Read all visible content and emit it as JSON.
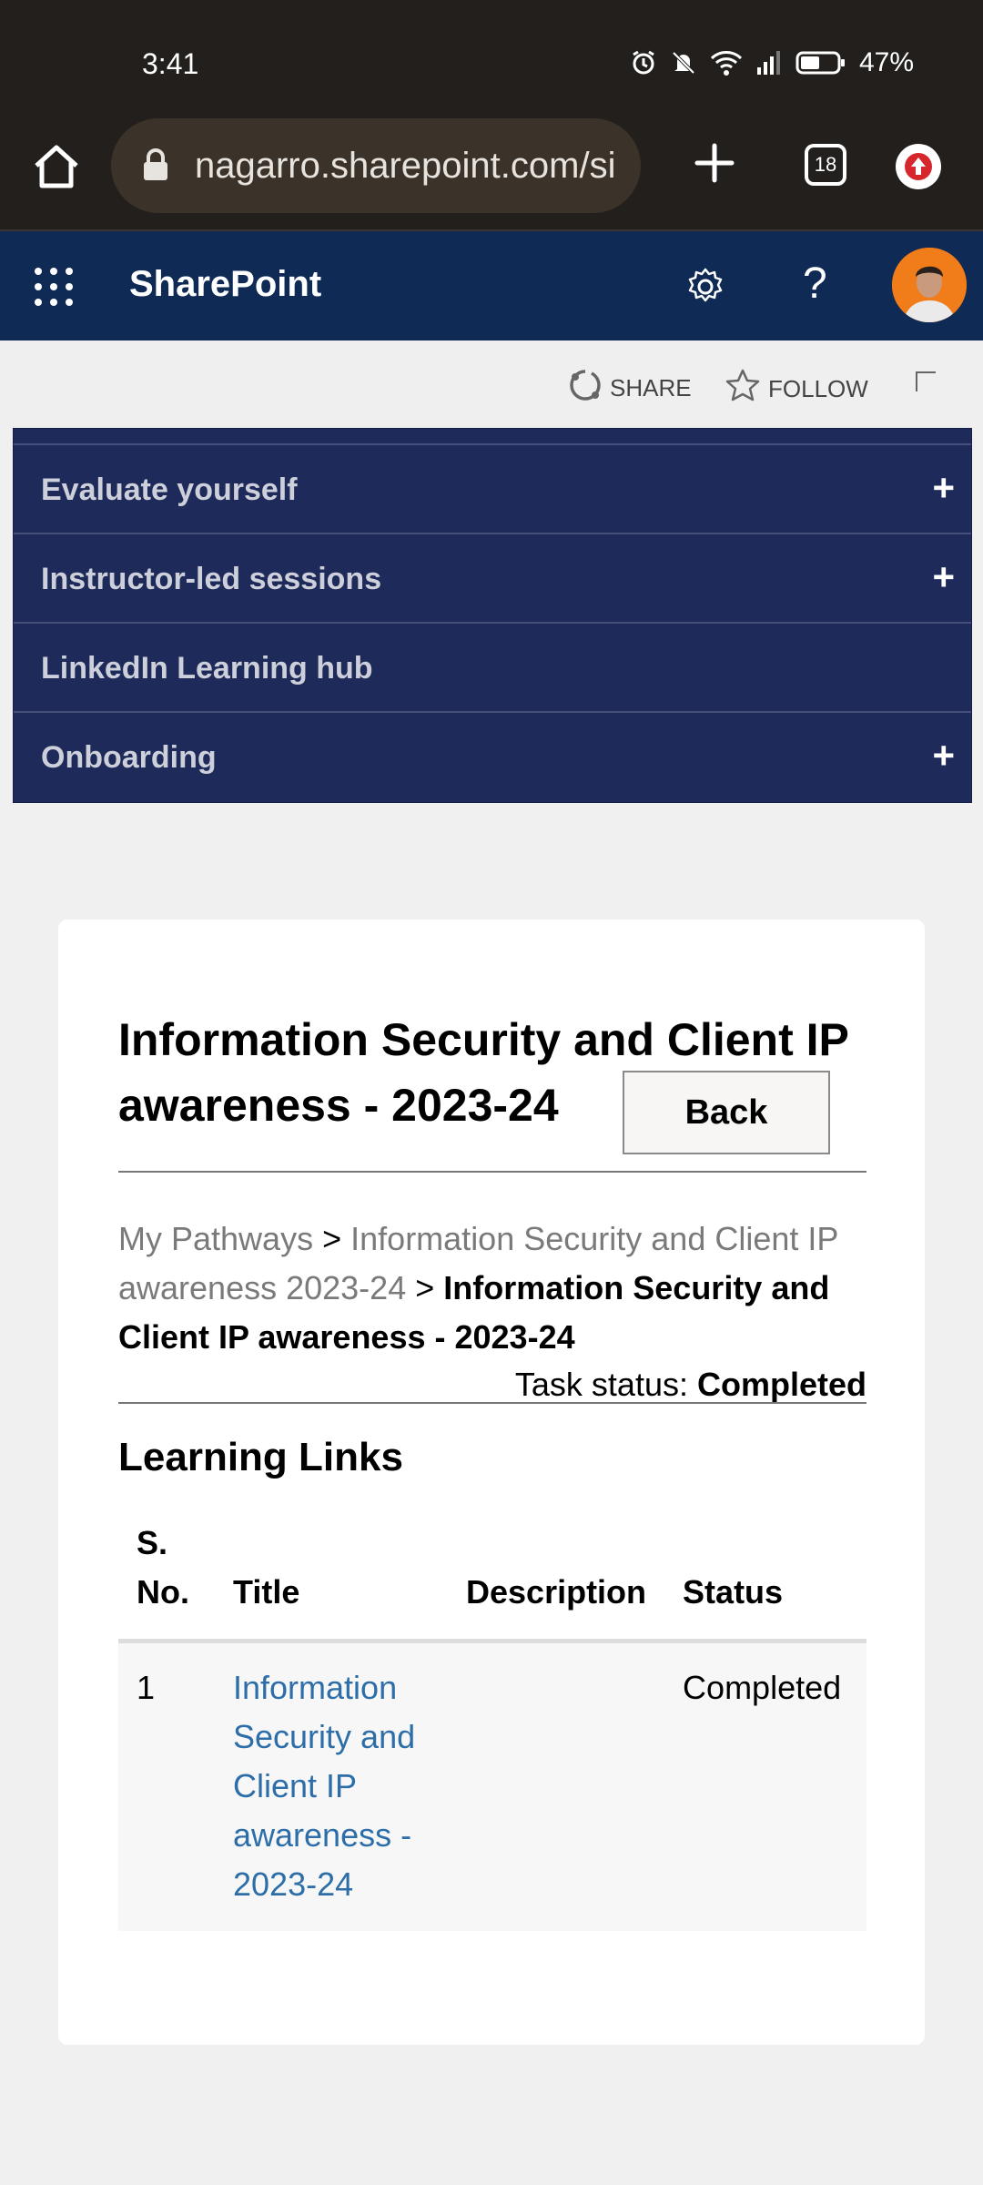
{
  "status_bar": {
    "time": "3:41",
    "battery": "47%",
    "icons": [
      "alarm-icon",
      "mute-icon",
      "wifi-icon",
      "signal-icon",
      "battery-icon"
    ]
  },
  "browser": {
    "url": "nagarro.sharepoint.com/si",
    "tab_count": "18"
  },
  "header": {
    "app_name": "SharePoint"
  },
  "actions": {
    "share": "SHARE",
    "follow": "FOLLOW"
  },
  "nav": {
    "items": [
      {
        "label": "Evaluate yourself",
        "expandable": true
      },
      {
        "label": "Instructor-led sessions",
        "expandable": true
      },
      {
        "label": "LinkedIn Learning hub",
        "expandable": false
      },
      {
        "label": "Onboarding",
        "expandable": true
      }
    ],
    "expand_glyph": "+"
  },
  "page": {
    "title": "Information Security and Client IP awareness - 2023-24",
    "back_label": "Back",
    "breadcrumb": {
      "crumb1": "My Pathways",
      "separator": ">",
      "crumb2": "Information Security and Client IP awareness 2023-24",
      "current": "Information Security and Client IP awareness - 2023-24"
    },
    "task_status_label": "Task status:",
    "task_status_value": "Completed",
    "section_title": "Learning Links",
    "table": {
      "headers": {
        "no": "S. No.",
        "title": "Title",
        "description": "Description",
        "status": "Status"
      },
      "rows": [
        {
          "no": "1",
          "title": "Information Security and Client IP awareness - 2023-24",
          "description": "",
          "status": "Completed"
        }
      ]
    }
  },
  "colors": {
    "status_bar_bg": "#221f1c",
    "header_bg": "#0f2a54",
    "nav_bg": "#1e2a5a",
    "link": "#2d6ea8"
  }
}
